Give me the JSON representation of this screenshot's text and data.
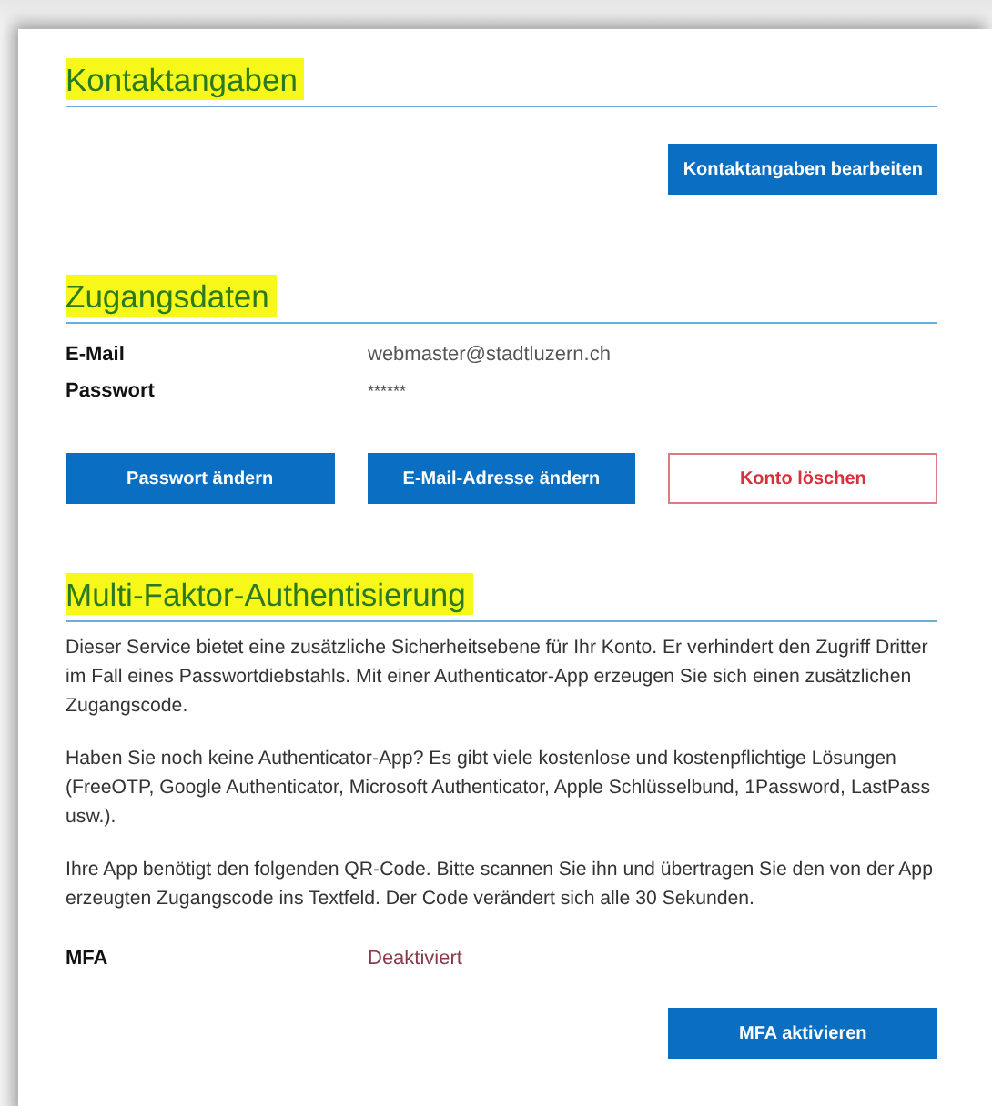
{
  "sections": [
    {
      "title": "Kontaktangaben",
      "highlighted": true,
      "buttons": [
        {
          "label": "Kontaktangaben bearbeiten",
          "kind": "primary"
        }
      ]
    },
    {
      "title": "Zugangsdaten",
      "highlighted": true,
      "fields": [
        {
          "label": "E-Mail",
          "value": "webmaster@stadtluzern.ch",
          "kind": "plain"
        },
        {
          "label": "Passwort",
          "value": "******",
          "kind": "masked"
        }
      ],
      "buttons": [
        {
          "label": "Passwort ändern",
          "kind": "primary"
        },
        {
          "label": "E-Mail-Adresse ändern",
          "kind": "primary"
        },
        {
          "label": "Konto löschen",
          "kind": "danger"
        }
      ]
    },
    {
      "title": "Multi-Faktor-Authentisierung",
      "highlighted": true,
      "paragraphs": [
        "Dieser Service bietet eine zusätzliche Sicherheitsebene für Ihr Konto. Er verhindert den Zugriff Dritter im Fall eines Passwortdiebstahls. Mit einer Authenticator-App erzeugen Sie sich einen zusätzlichen Zugangscode.",
        "Haben Sie noch keine Authenticator-App? Es gibt viele kostenlose und kostenpflichtige Lösungen (FreeOTP, Google Authenticator, Microsoft Authenticator, Apple Schlüsselbund, 1Password, LastPass usw.).",
        "Ihre App benötigt den folgenden QR-Code. Bitte scannen Sie ihn und übertragen Sie den von der App erzeugten Zugangscode ins Textfeld. Der Code verändert sich alle 30 Sekunden."
      ],
      "fields": [
        {
          "label": "MFA",
          "value": "Deaktiviert",
          "kind": "status"
        }
      ],
      "buttons": [
        {
          "label": "MFA aktivieren",
          "kind": "primary"
        }
      ]
    }
  ]
}
